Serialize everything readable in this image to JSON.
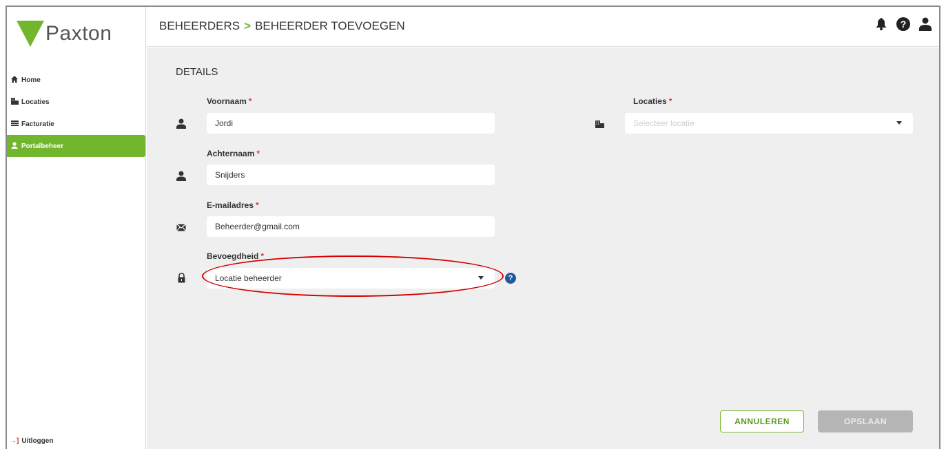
{
  "brand": {
    "name": "Paxton",
    "accent": "#72b62e"
  },
  "sidebar": {
    "items": [
      {
        "label": "Home",
        "icon": "home-icon"
      },
      {
        "label": "Locaties",
        "icon": "building-icon"
      },
      {
        "label": "Facturatie",
        "icon": "bars-icon"
      },
      {
        "label": "Portalbeheer",
        "icon": "user-icon",
        "active": true
      }
    ],
    "logout": "Uitloggen"
  },
  "header": {
    "crumb_parent": "BEHEERDERS",
    "crumb_separator": ">",
    "crumb_current": "BEHEERDER TOEVOEGEN",
    "icons": [
      "bell-icon",
      "help-icon",
      "user-icon"
    ]
  },
  "form": {
    "section_title": "DETAILS",
    "required_mark": "*",
    "first_name": {
      "label": "Voornaam",
      "value": "Jordi"
    },
    "last_name": {
      "label": "Achternaam",
      "value": "Snijders"
    },
    "email": {
      "label": "E-mailadres",
      "value": "Beheerder@gmail.com"
    },
    "role": {
      "label": "Bevoegdheid",
      "value": "Locatie beheerder"
    },
    "locations": {
      "label": "Locaties",
      "placeholder": "Selecteer locatie"
    }
  },
  "actions": {
    "cancel": "ANNULEREN",
    "save": "OPSLAAN"
  }
}
